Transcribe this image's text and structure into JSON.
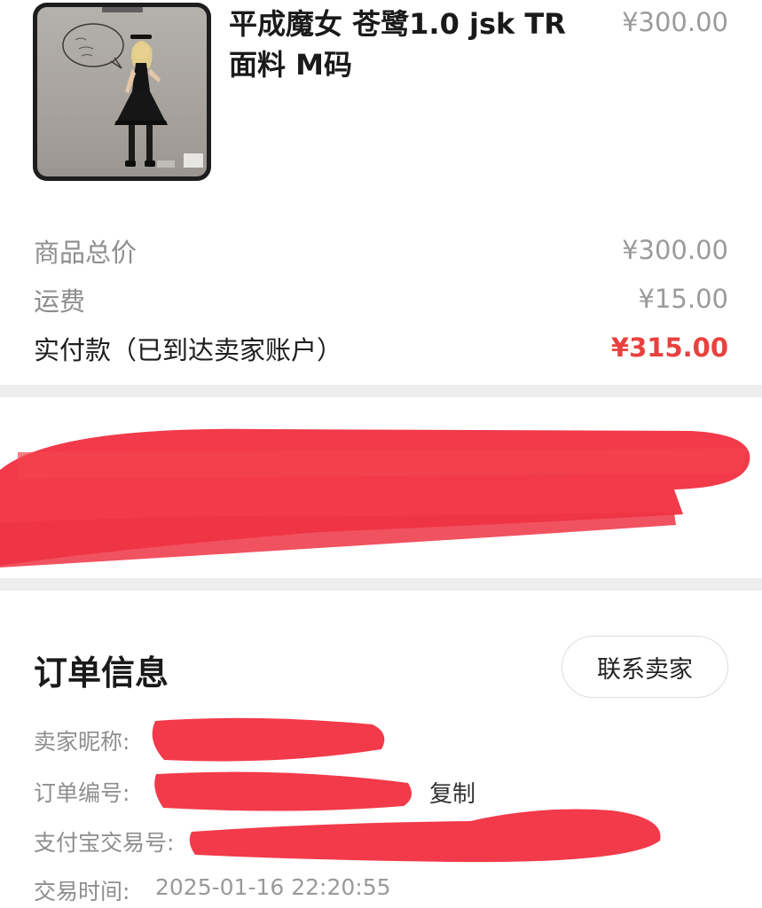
{
  "product": {
    "title_line1": "平成魔女 苍鹭1.0 jsk TR",
    "title_line2": "面料 M码",
    "price": "¥300.00",
    "image_icon": "product-photo"
  },
  "summary": {
    "subtotal_label": "商品总价",
    "subtotal_value": "¥300.00",
    "shipping_label": "运费",
    "shipping_value": "¥15.00",
    "paid_label": "实付款（已到达卖家账户）",
    "paid_value": "¥315.00"
  },
  "order_info": {
    "title": "订单信息",
    "contact_button": "联系卖家",
    "seller_label": "卖家昵称:",
    "order_no_label": "订单编号:",
    "copy_label": "复制",
    "alipay_label": "支付宝交易号:",
    "time_label": "交易时间:",
    "time_value": "2025-01-16 22:20:55"
  },
  "colors": {
    "accent_red": "#e8413e",
    "redaction_red": "#f23a4a"
  }
}
